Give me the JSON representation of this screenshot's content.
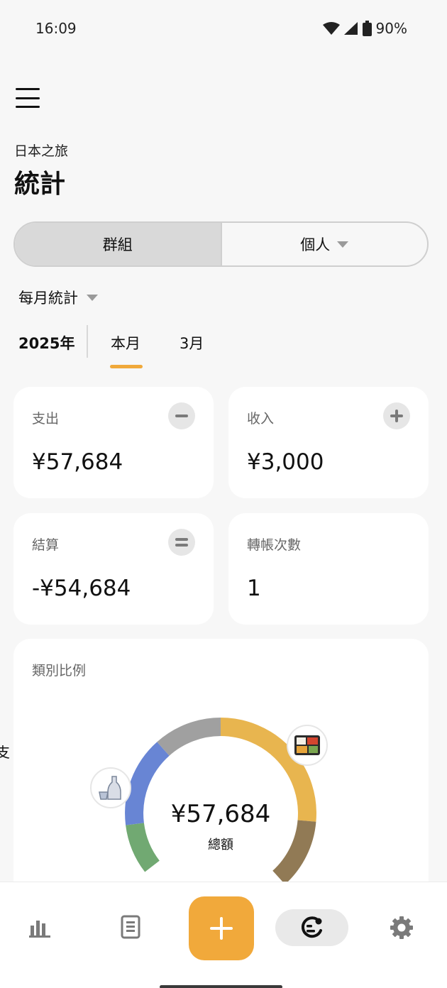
{
  "status_bar": {
    "time": "16:09",
    "battery": "90%"
  },
  "header": {
    "trip_name": "日本之旅",
    "title": "統計"
  },
  "segment": {
    "group_label": "群組",
    "personal_label": "個人"
  },
  "period": {
    "mode_label": "每月統計",
    "year": "2025年",
    "tabs": [
      "本月",
      "3月"
    ]
  },
  "cards": {
    "expense": {
      "label": "支出",
      "value": "¥57,684"
    },
    "income": {
      "label": "收入",
      "value": "¥3,000"
    },
    "balance": {
      "label": "結算",
      "value": "-¥54,684"
    },
    "transfers": {
      "label": "轉帳次數",
      "value": "1"
    }
  },
  "category_chart": {
    "title": "類別比例",
    "center_value": "¥57,684",
    "center_label": "總額"
  },
  "side_glyph": "支",
  "colors": {
    "accent": "#f0a93a",
    "fab": "#f1a93b",
    "seg_yellow": "#e8b54f",
    "seg_brown": "#917a55",
    "seg_green": "#71a972",
    "seg_blue": "#6885d4",
    "seg_gray": "#a0a0a0"
  },
  "icons": {
    "menu": "hamburger-icon",
    "stats": "bar-chart-icon",
    "records": "document-list-icon",
    "add": "plus-icon",
    "profile": "face-icon",
    "settings": "gear-icon",
    "expense_badge": "minus-icon",
    "income_badge": "plus-icon",
    "balance_badge": "equals-icon",
    "category_food": "bento-icon",
    "category_drink": "sake-icon"
  }
}
